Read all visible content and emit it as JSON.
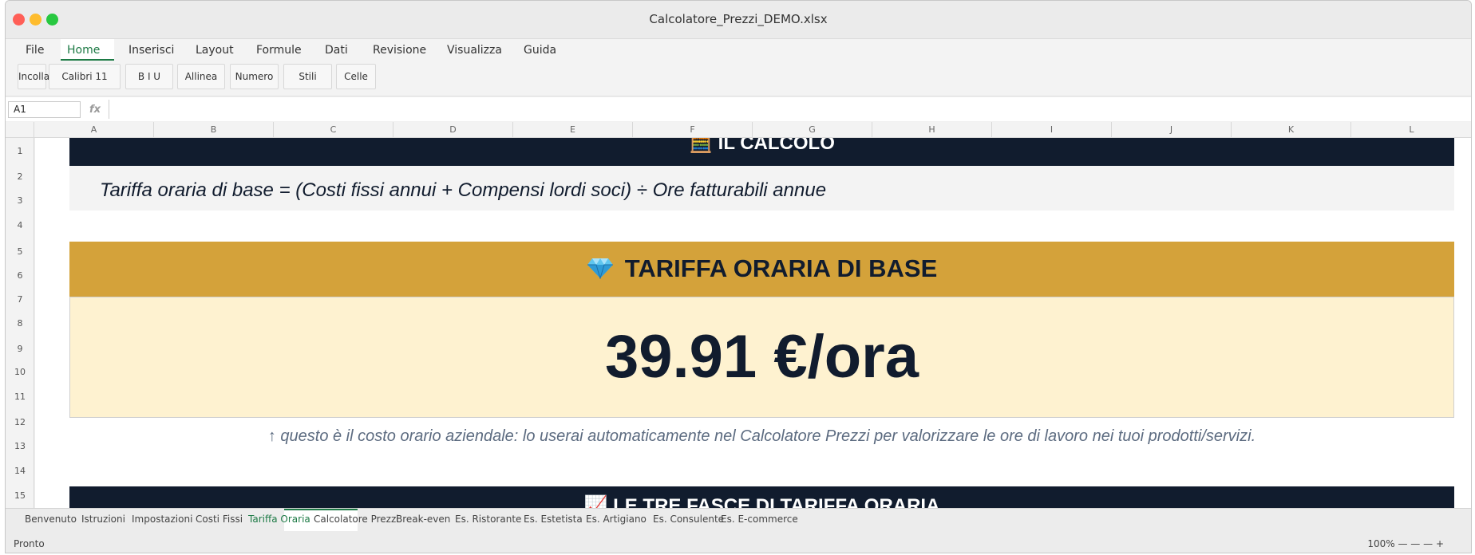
{
  "window": {
    "title": "Calcolatore_Prezzi_DEMO.xlsx"
  },
  "menu": [
    "File",
    "Home",
    "Inserisci",
    "Layout",
    "Formule",
    "Dati",
    "Revisione",
    "Visualizza",
    "Guida"
  ],
  "ribbon": [
    "Incolla",
    "Calibri 11",
    "B I U",
    "Allinea",
    "Numero",
    "Stili",
    "Celle"
  ],
  "formula_bar": {
    "name_box": "A1",
    "fx": "fx",
    "content": ""
  },
  "columns": [
    "A",
    "B",
    "C",
    "D",
    "E",
    "F",
    "G",
    "H",
    "I",
    "J",
    "K",
    "L"
  ],
  "rows": [
    "1",
    "2",
    "3",
    "4",
    "5",
    "6",
    "7",
    "8",
    "9",
    "10",
    "11",
    "12",
    "13",
    "14",
    "15"
  ],
  "sheet": {
    "calc_header": "🧮 IL CALCOLO",
    "formula": "Tariffa oraria di base = (Costi fissi annui + Compensi lordi soci) ÷ Ore fatturabili annue",
    "result_header": "TARIFFA ORARIA DI BASE",
    "result_icon": "gem-icon",
    "result_value": "39.91 €/ora",
    "note": "↑ questo è il costo orario aziendale: lo userai automaticamente nel Calcolatore Prezzi per valorizzare le ore di lavoro nei tuoi prodotti/servizi.",
    "bands_header": "📈 LE TRE FASCE DI TARIFFA ORARIA",
    "colors": {
      "dark": "#111c2e",
      "gold": "#d4a23a",
      "cream": "#fef2d0",
      "accent": "#1d7a45"
    }
  },
  "tabs": [
    "Benvenuto",
    "Istruzioni",
    "Impostazioni",
    "Costi Fissi",
    "Tariffa Oraria",
    "Calcolatore Prezzi",
    "Break-even",
    "Es. Ristorante",
    "Es. Estetista",
    "Es. Artigiano",
    "Es. Consulente",
    "Es. E-commerce"
  ],
  "active_tab": "Tariffa Oraria",
  "status": {
    "left": "Pronto",
    "zoom": "100% — — — +"
  }
}
